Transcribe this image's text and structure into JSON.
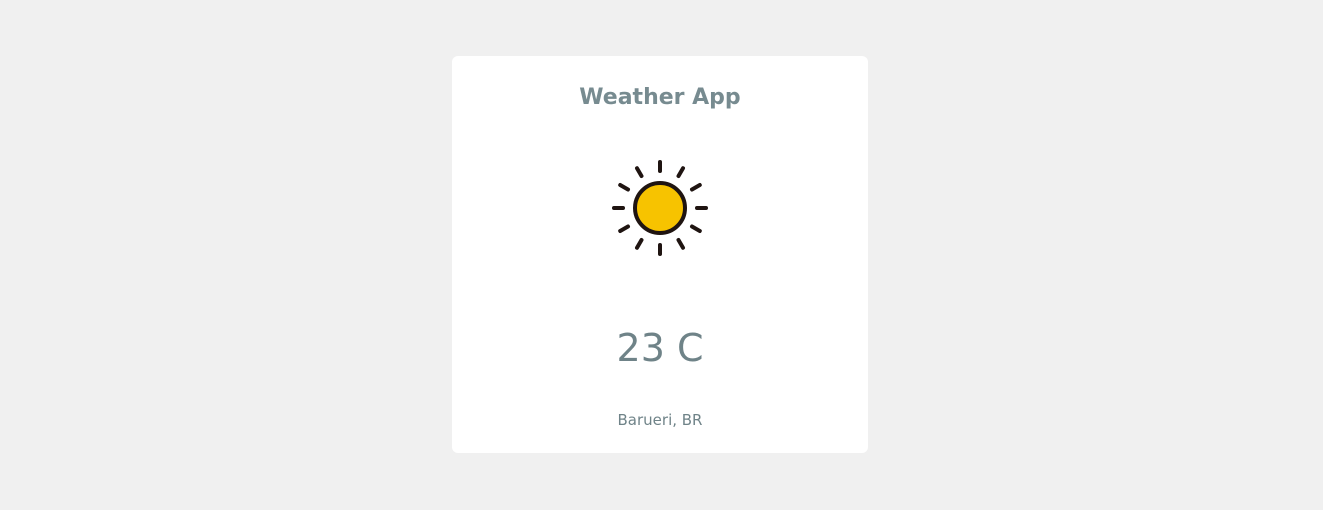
{
  "app": {
    "title": "Weather App"
  },
  "weather": {
    "icon": "sun-icon",
    "temperature": "23 C",
    "location": "Barueri, BR"
  },
  "colors": {
    "page_background": "#f0f0f0",
    "card_background": "#ffffff",
    "text": "#778b90",
    "sun_fill": "#f7c300",
    "sun_stroke": "#1f1411"
  }
}
